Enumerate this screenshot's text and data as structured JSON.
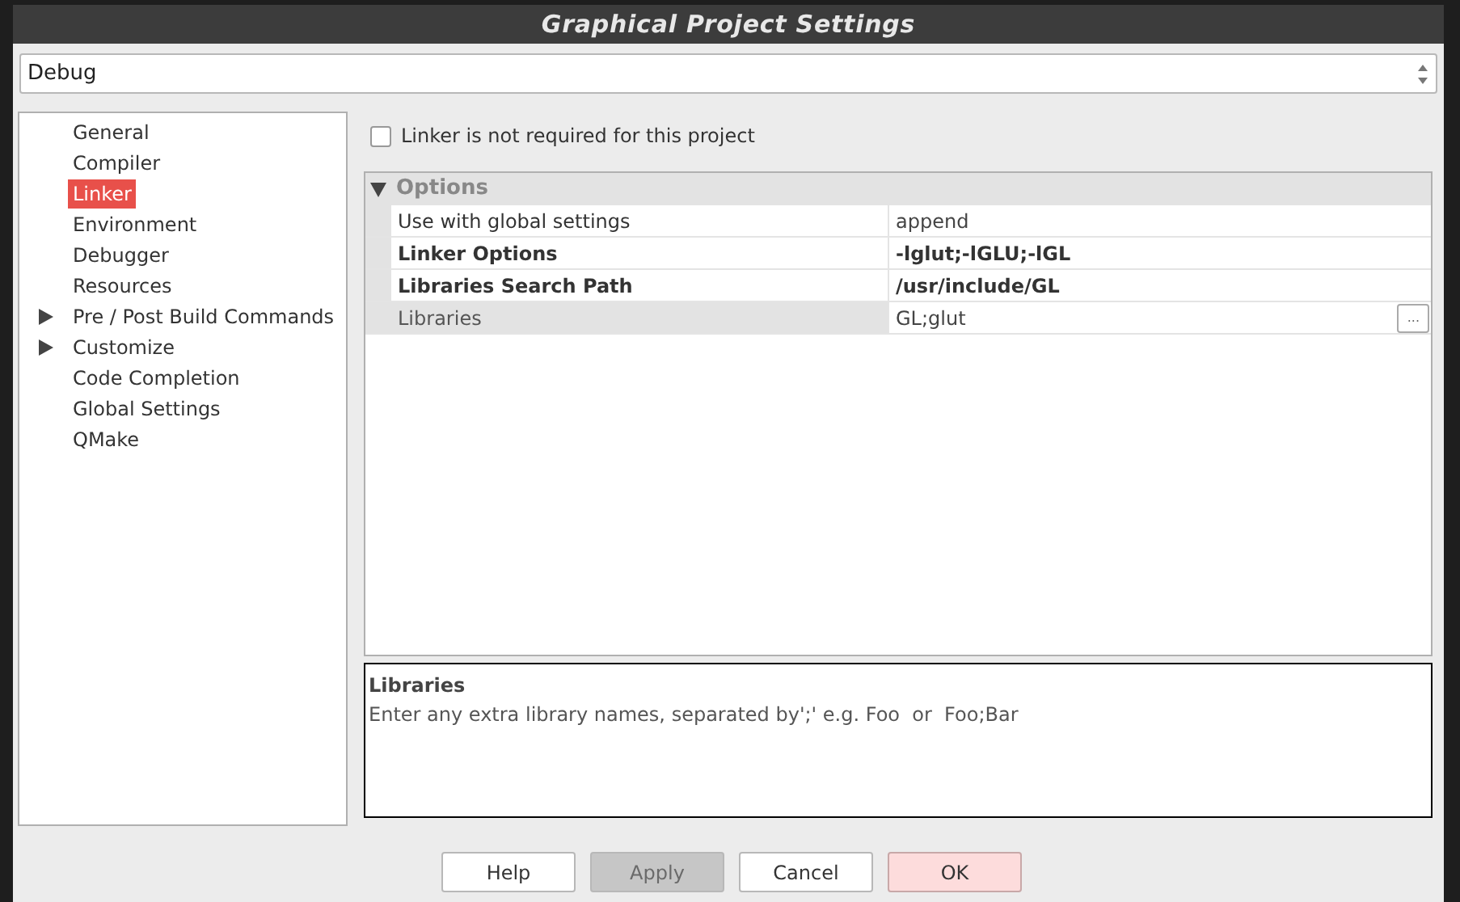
{
  "window": {
    "title": "Graphical Project Settings"
  },
  "configuration": {
    "value": "Debug"
  },
  "sidebar": {
    "items": [
      {
        "label": "General",
        "selected": false,
        "has_children": false
      },
      {
        "label": "Compiler",
        "selected": false,
        "has_children": false
      },
      {
        "label": "Linker",
        "selected": true,
        "has_children": false
      },
      {
        "label": "Environment",
        "selected": false,
        "has_children": false
      },
      {
        "label": "Debugger",
        "selected": false,
        "has_children": false
      },
      {
        "label": "Resources",
        "selected": false,
        "has_children": false
      },
      {
        "label": "Pre / Post Build Commands",
        "selected": false,
        "has_children": true
      },
      {
        "label": "Customize",
        "selected": false,
        "has_children": true
      },
      {
        "label": "Code Completion",
        "selected": false,
        "has_children": false
      },
      {
        "label": "Global Settings",
        "selected": false,
        "has_children": false
      },
      {
        "label": "QMake",
        "selected": false,
        "has_children": false
      }
    ]
  },
  "linker_not_required": {
    "label": "Linker is not required for this project",
    "checked": false
  },
  "properties": {
    "group": {
      "label": "Options",
      "expanded": true
    },
    "rows": [
      {
        "name": "Use with global settings",
        "value": "append",
        "bold": false,
        "selected": false
      },
      {
        "name": "Linker Options",
        "value": "-lglut;-lGLU;-lGL",
        "bold": true,
        "selected": false
      },
      {
        "name": "Libraries Search Path",
        "value": "/usr/include/GL",
        "bold": true,
        "selected": false
      },
      {
        "name": "Libraries",
        "value": "GL;glut",
        "bold": false,
        "selected": true,
        "button": "..."
      }
    ]
  },
  "description": {
    "title": "Libraries",
    "text": "Enter any extra library names, separated by';' e.g. Foo  or  Foo;Bar"
  },
  "buttons": [
    {
      "label": "Help",
      "kind": "normal",
      "disabled": false
    },
    {
      "label": "Apply",
      "kind": "normal",
      "disabled": true
    },
    {
      "label": "Cancel",
      "kind": "normal",
      "disabled": false
    },
    {
      "label": "OK",
      "kind": "default",
      "disabled": false
    }
  ]
}
